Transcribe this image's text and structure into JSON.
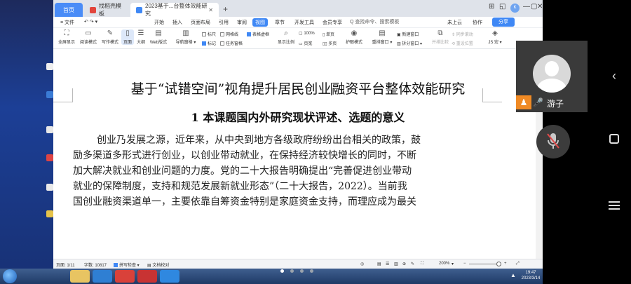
{
  "tabs": {
    "home": "首页",
    "template": "找稻壳模板",
    "document": "2023基于...台整体效能研究",
    "new_tab": "+"
  },
  "window_controls": {
    "grid": "⊞",
    "skin": "◱",
    "user_initials": "K",
    "minimize": "—",
    "maximize": "▢",
    "close": "✕"
  },
  "menu": {
    "file": "≡ 文件",
    "items": [
      "开始",
      "插入",
      "页面布局",
      "引用",
      "审阅",
      "视图",
      "章节",
      "开发工具",
      "会员专享"
    ],
    "active": "视图",
    "search_placeholder": "Q 查找命令、搜索模板",
    "cloud": "未上云",
    "collab": "协作",
    "share": "分享"
  },
  "ribbon": {
    "view_modes": [
      "全屏显示",
      "阅读模式",
      "写作模式",
      "页面",
      "大纲",
      "Web版式"
    ],
    "nav_pane": "导航窗格 ▾",
    "checks_col1": [
      {
        "label": "标尺",
        "checked": false
      },
      {
        "label": "标记",
        "checked": true
      }
    ],
    "checks_col2": [
      {
        "label": "网格线",
        "checked": false
      },
      {
        "label": "任务窗格",
        "checked": false
      }
    ],
    "checks_col3": [
      {
        "label": "表格虚框",
        "checked": true
      }
    ],
    "zoom": {
      "label": "显示比例",
      "percent": "100%",
      "single": "单页",
      "page_width": "页宽",
      "multi": "多页"
    },
    "eye": "护眼模式",
    "rearrange": "重排窗口 ▾",
    "new_window": "新建窗口",
    "split": "拆分窗口 ▾",
    "side_by_side": "并排比较",
    "sync_scroll": "同步滚动",
    "reset_pos": "重设位置",
    "js_macro": "JS 宏 ▾"
  },
  "document": {
    "title_before_caret": "基于“试错空间”视角提升居民创业",
    "title_after_caret": "融资平台整体效能研究",
    "heading": "1 本课题国内外研究现状评述、选题的意义",
    "paragraph_lines": [
      "创业乃发展之源，近年来，从中央到地方各级政府纷纷出台相关的政策，鼓",
      "励多渠道多形式进行创业，以创业带动就业，在保持经济较快增长的同时，不断",
      "加大解决就业和创业问题的力度。党的二十大报告明确提出“完善促进创业带动",
      "就业的保障制度，支持和规范发展新就业形态”（二十大报告，2022）。当前我",
      "国创业融资渠道单一，主要依靠自筹资金特别是家庭资金支持，而理应成为最关"
    ]
  },
  "status": {
    "page": "页面: 1/11",
    "words": "字数: 10817",
    "spellcheck": "拼写检查 ▾",
    "proofread": "文档校对",
    "zoom": "200%",
    "zoom_minus": "−",
    "zoom_plus": "+"
  },
  "taskbar": {
    "tray_up": "▲",
    "clock_time": "19:47",
    "clock_date": "2023/3/14"
  },
  "video": {
    "user_name": "游子"
  },
  "colors": {
    "accent": "#3f88f5",
    "home_tab": "#4a8cf7",
    "badge_orange": "#f08a24",
    "mic_green": "#28c45a"
  }
}
